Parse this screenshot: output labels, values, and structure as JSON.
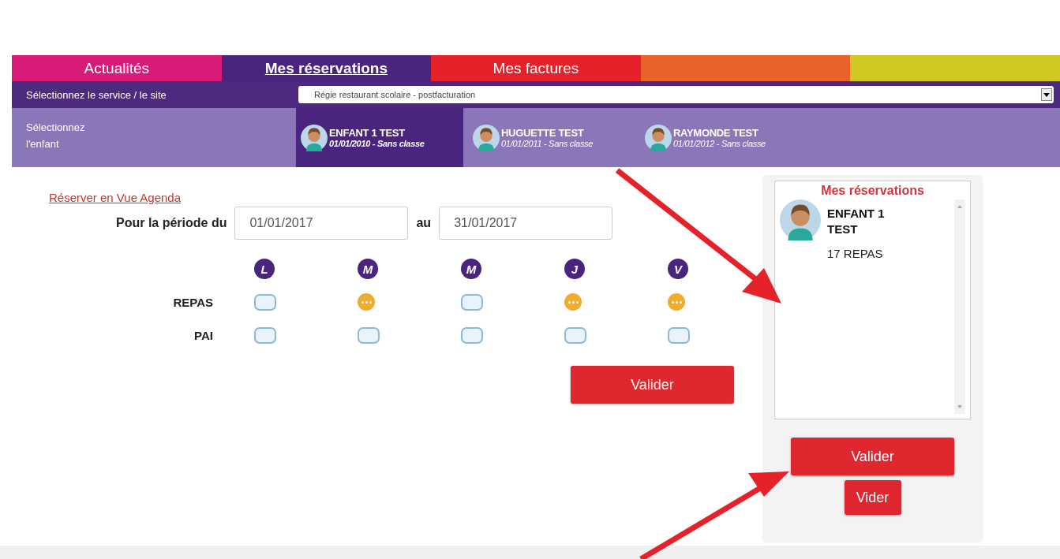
{
  "tabs": [
    {
      "label": "Actualités",
      "selected": false,
      "color": "#d81b78"
    },
    {
      "label": "Mes réservations",
      "selected": true,
      "color": "#4a2580"
    },
    {
      "label": "Mes factures",
      "selected": false,
      "color": "#e52229"
    }
  ],
  "color_bands": [
    {
      "color": "#e8622a"
    },
    {
      "color": "#cfc823"
    }
  ],
  "service": {
    "label": "Sélectionnez le service / le site",
    "value": "Régie restaurant scolaire - postfacturation"
  },
  "children_bar": {
    "label": "Sélectionnez l'enfant",
    "children": [
      {
        "name": "ENFANT 1 TEST",
        "info": "01/01/2010 - Sans classe",
        "selected": true
      },
      {
        "name": "HUGUETTE TEST",
        "info": "01/01/2011 - Sans classe",
        "selected": false
      },
      {
        "name": "RAYMONDE TEST",
        "info": "01/01/2012 - Sans classe",
        "selected": false
      }
    ]
  },
  "agenda_link": "Réserver en Vue Agenda",
  "period": {
    "label": "Pour la période du",
    "from": "01/01/2017",
    "to_label": "au",
    "to": "31/01/2017"
  },
  "days": [
    "L",
    "M",
    "M",
    "J",
    "V"
  ],
  "rows": [
    {
      "label": "REPAS",
      "cells": [
        {
          "reserved": false
        },
        {
          "reserved": true
        },
        {
          "reserved": false
        },
        {
          "reserved": true
        },
        {
          "reserved": true
        }
      ]
    },
    {
      "label": "PAI",
      "cells": [
        {
          "reserved": false
        },
        {
          "reserved": false
        },
        {
          "reserved": false
        },
        {
          "reserved": false
        },
        {
          "reserved": false
        }
      ]
    }
  ],
  "validate_button": "Valider",
  "summary": {
    "title": "Mes réservations",
    "entries": [
      {
        "name": "ENFANT 1 TEST",
        "count": "17 REPAS"
      }
    ],
    "validate_button": "Valider",
    "clear_button": "Vider"
  }
}
